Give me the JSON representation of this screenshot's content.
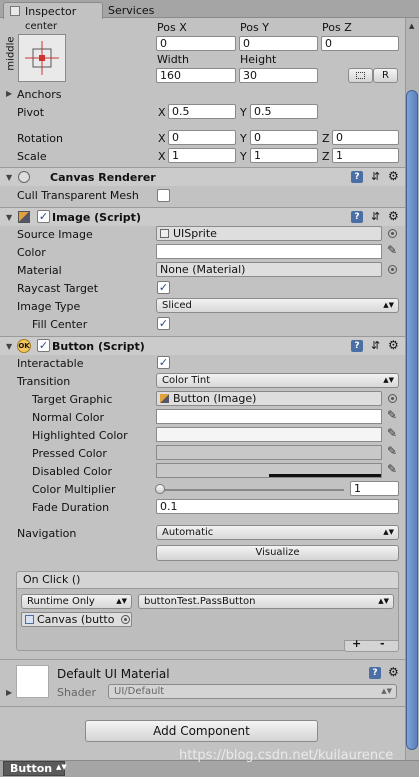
{
  "tabs": {
    "inspector": "Inspector",
    "services": "Services"
  },
  "rect": {
    "anchor_top": "center",
    "anchor_side": "middle",
    "pos_x_label": "Pos X",
    "pos_y_label": "Pos Y",
    "pos_z_label": "Pos Z",
    "pos_x": "0",
    "pos_y": "0",
    "pos_z": "0",
    "width_label": "Width",
    "height_label": "Height",
    "width": "160",
    "height": "30",
    "raw_button": "R",
    "anchors_label": "Anchors",
    "pivot_label": "Pivot",
    "pivot_x": "0.5",
    "pivot_y": "0.5",
    "rotation_label": "Rotation",
    "rot_x": "0",
    "rot_y": "0",
    "rot_z": "0",
    "scale_label": "Scale",
    "scale_x": "1",
    "scale_y": "1",
    "scale_z": "1",
    "x": "X",
    "y": "Y",
    "z": "Z"
  },
  "canvas_renderer": {
    "title": "Canvas Renderer",
    "cull_label": "Cull Transparent Mesh"
  },
  "image": {
    "title": "Image (Script)",
    "source_label": "Source Image",
    "source_value": "UISprite",
    "color_label": "Color",
    "material_label": "Material",
    "material_value": "None (Material)",
    "raycast_label": "Raycast Target",
    "type_label": "Image Type",
    "type_value": "Sliced",
    "fill_label": "Fill Center"
  },
  "button": {
    "title": "Button (Script)",
    "interactable_label": "Interactable",
    "transition_label": "Transition",
    "transition_value": "Color Tint",
    "target_label": "Target Graphic",
    "target_value": "Button (Image)",
    "normal_label": "Normal Color",
    "highlighted_label": "Highlighted Color",
    "pressed_label": "Pressed Color",
    "disabled_label": "Disabled Color",
    "multiplier_label": "Color Multiplier",
    "multiplier_value": "1",
    "multiplier_fraction": 0.0,
    "fade_label": "Fade Duration",
    "fade_value": "0.1",
    "navigation_label": "Navigation",
    "navigation_value": "Automatic",
    "visualize": "Visualize",
    "onclick_label": "On Click ()",
    "runtime_value": "Runtime Only",
    "function_value": "buttonTest.PassButton",
    "object_value": "Canvas (butto",
    "plus": "+",
    "minus": "-"
  },
  "material": {
    "name": "Default UI Material",
    "shader_label": "Shader",
    "shader_value": "UI/Default"
  },
  "add_component": "Add Component",
  "footer": {
    "object_name": "Button",
    "watermark": "https://blog.csdn.net/kuilaurence"
  },
  "colors": {
    "panel": "#c2c2c2",
    "header": "#cbcbcb",
    "accent_check": "#2a4a8a"
  }
}
